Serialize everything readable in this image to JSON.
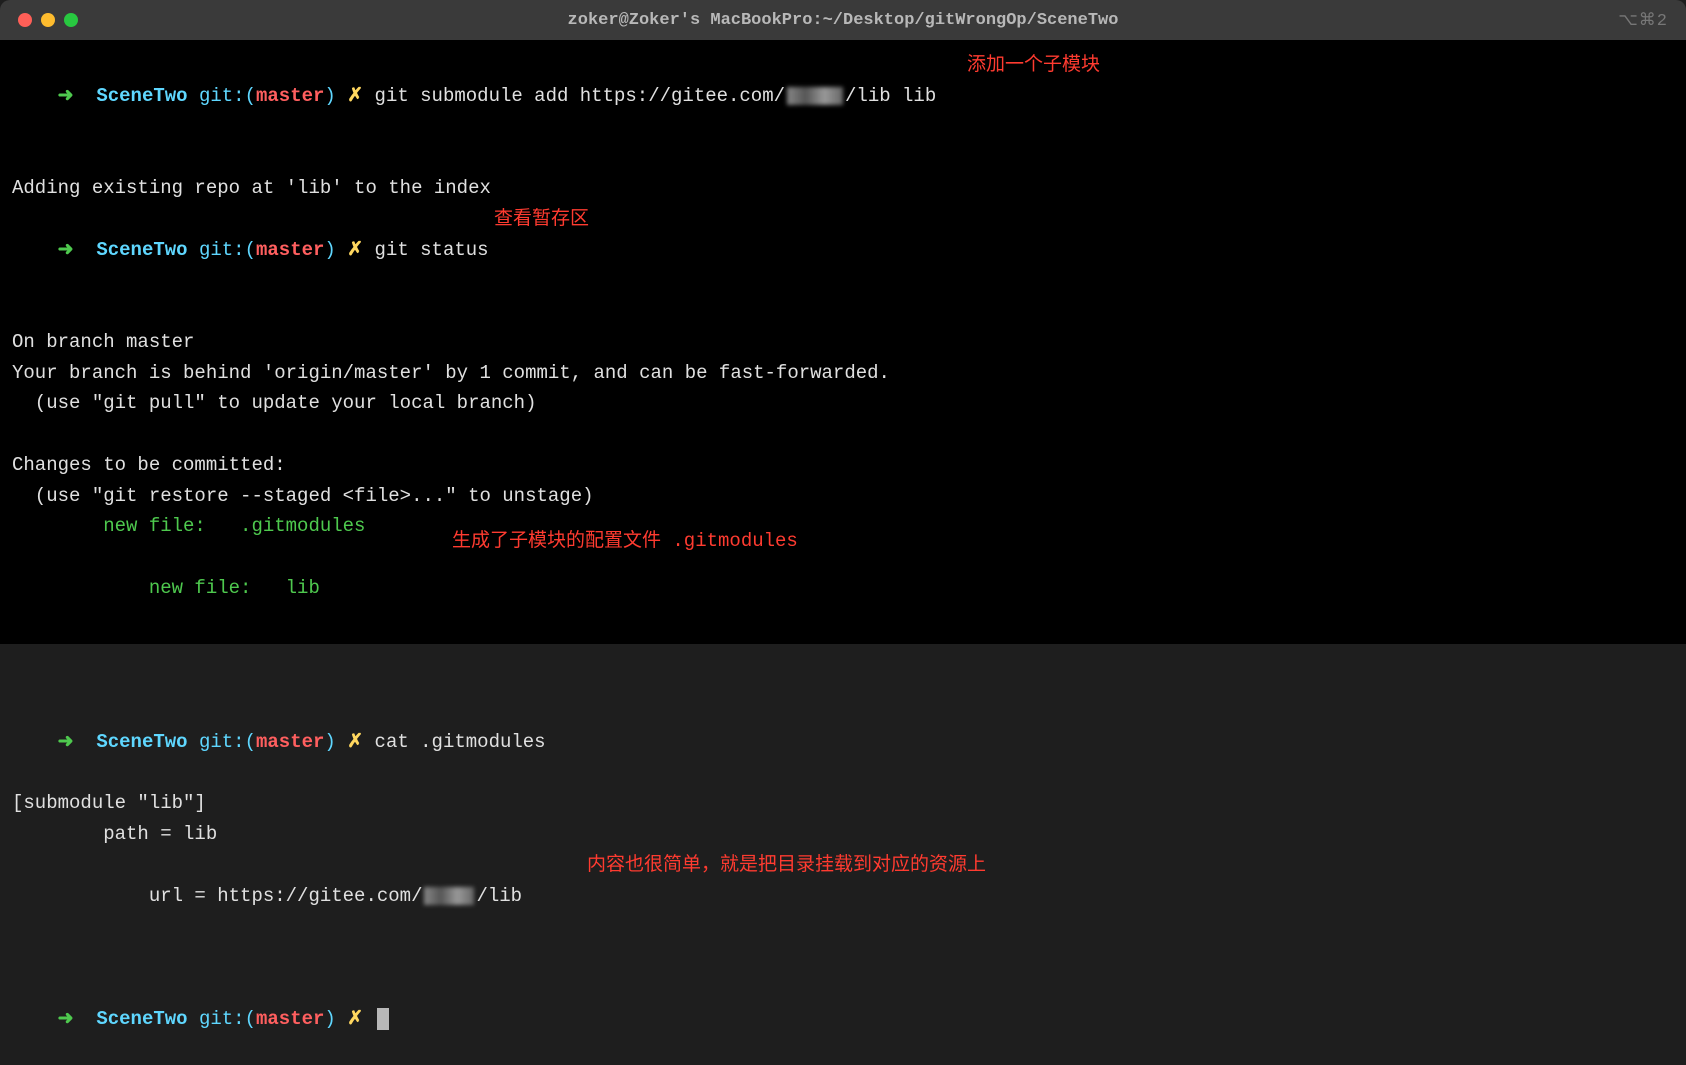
{
  "titlebar": {
    "title": "zoker@Zoker's MacBookPro:~/Desktop/gitWrongOp/SceneTwo",
    "shortcut": "⌥⌘2"
  },
  "prompt": {
    "arrow": "➜",
    "dir": "SceneTwo",
    "git_prefix": "git:(",
    "branch": "master",
    "git_suffix": ")",
    "mark": "✗"
  },
  "lines": {
    "cmd1": "git submodule add https://gitee.com/",
    "cmd1_suffix": "/lib lib",
    "out1": "Adding existing repo at 'lib' to the index",
    "cmd2": "git status",
    "out2a": "On branch master",
    "out2b": "Your branch is behind 'origin/master' by 1 commit, and can be fast-forwarded.",
    "out2c": "  (use \"git pull\" to update your local branch)",
    "out2d": "Changes to be committed:",
    "out2e": "  (use \"git restore --staged <file>...\" to unstage)",
    "out2f": "        new file:   .gitmodules",
    "out2g": "        new file:   lib",
    "cmd3": "cat .gitmodules",
    "out3a": "[submodule \"lib\"]",
    "out3b": "        path = lib",
    "out3c": "        url = https://gitee.com/",
    "out3c_suffix": "/lib"
  },
  "annotations": {
    "a1": "添加一个子模块",
    "a2": "查看暂存区",
    "a3": "生成了子模块的配置文件 .gitmodules",
    "a4": "内容也很简单，就是把目录挂载到对应的资源上"
  }
}
